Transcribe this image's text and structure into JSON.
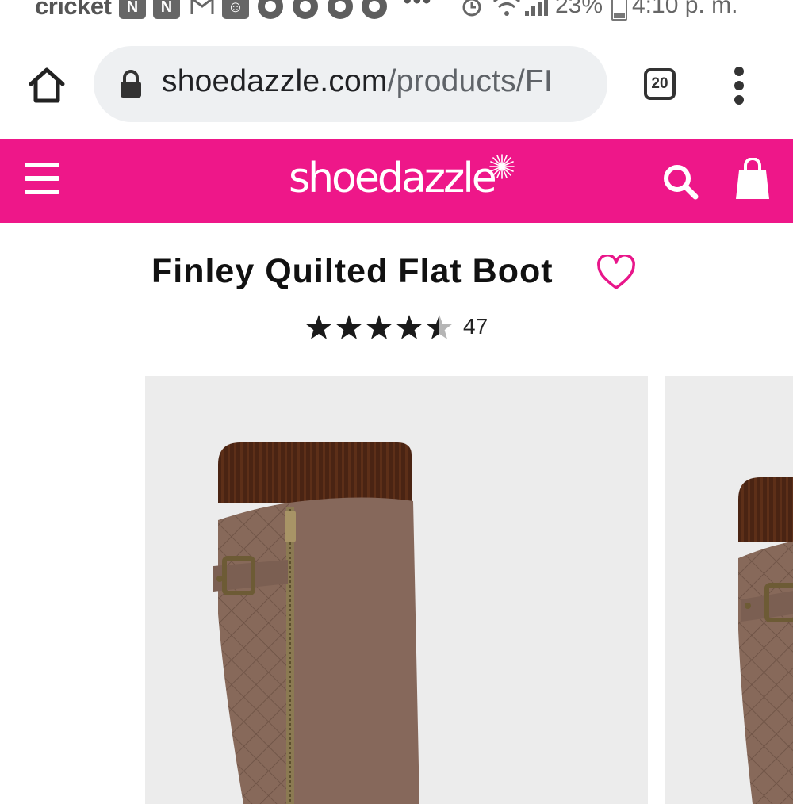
{
  "status_bar": {
    "carrier": "cricket",
    "battery": "23%",
    "time": "4:10 p. m.",
    "dots": "•••",
    "notif_icons": [
      "notification-icon",
      "notification-icon",
      "gmail-icon",
      "mask-icon",
      "chrome-icon",
      "chrome-icon",
      "chrome-icon",
      "chrome-icon"
    ],
    "system_icons": [
      "alarm-icon",
      "wifi-icon",
      "signal-icon",
      "battery-icon"
    ]
  },
  "browser": {
    "url_domain": "shoedazzle.com",
    "url_path": "/products/FI",
    "tab_count": "20",
    "icons": [
      "home-icon",
      "lock-icon",
      "tab-switcher-icon",
      "overflow-menu-icon"
    ]
  },
  "site_header": {
    "logo_text": "shoedazzle",
    "brand_color": "#ee1789",
    "icons": [
      "hamburger-menu-icon",
      "search-icon",
      "shopping-bag-icon"
    ]
  },
  "product": {
    "title": "Finley Quilted Flat Boot",
    "rating": 4.5,
    "rating_max": 5,
    "review_count": "47",
    "wishlist_icon": "heart-icon"
  },
  "gallery": {
    "images": [
      "boot-image-main",
      "boot-image-next"
    ]
  }
}
